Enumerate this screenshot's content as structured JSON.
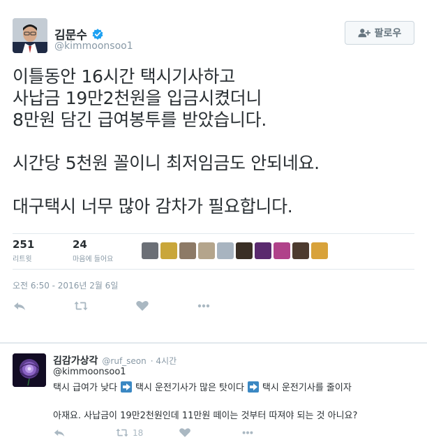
{
  "tweet": {
    "display_name": "김문수",
    "handle": "@kimmoonsoo1",
    "follow_label": "팔로우",
    "text_lines": [
      "이틀동안 16시간 택시기사하고",
      "사납금 19만2천원을 입금시켰더니",
      "8만원 담긴 급여봉투를 받았습니다.",
      "시간당 5천원 꼴이니 최저임금도 안되네요.",
      "대구택시 너무 많아 감차가 필요합니다."
    ],
    "stats": {
      "retweets_count": "251",
      "retweets_label": "리트윗",
      "likes_count": "24",
      "likes_label": "마음에 들어요"
    },
    "likers": [
      {
        "icon": "liker-avatar",
        "color": "#6b6f76"
      },
      {
        "icon": "liker-avatar",
        "color": "#c9a63a"
      },
      {
        "icon": "liker-avatar",
        "color": "#8d7a66"
      },
      {
        "icon": "liker-avatar",
        "color": "#b4a58c"
      },
      {
        "icon": "liker-avatar",
        "color": "#a8b4c0"
      },
      {
        "icon": "liker-avatar",
        "color": "#3a2f25"
      },
      {
        "icon": "liker-avatar",
        "color": "#5a2a6e"
      },
      {
        "icon": "liker-avatar",
        "color": "#b0428a"
      },
      {
        "icon": "liker-avatar",
        "color": "#4d3b2f"
      },
      {
        "icon": "liker-avatar",
        "color": "#d8a23a"
      }
    ],
    "timestamp": "오전 6:50 - 2016년 2월 6일",
    "actions": [
      "reply-icon",
      "retweet-icon",
      "like-icon",
      "more-icon"
    ]
  },
  "reply": {
    "display_name": "김감가상각",
    "handle": "@ruf_seon",
    "time": "· 4시간",
    "mention": "@kimmoonsoo1",
    "line1_parts": [
      "택시 급여가 낮다",
      "택시 운전기사가 많은 탓이다",
      "택시 운전기사를 줄이자"
    ],
    "line2": "아재요. 사납금이 19만2천원인데 11만원 떼이는 것부터 따져야 되는 것 아니요?",
    "retweet_count": "18"
  },
  "colors": {
    "text": "#292f33",
    "muted": "#8899a6",
    "verified": "#1da1f2",
    "action_icon": "#aab8c2",
    "divider": "#e1e8ed"
  }
}
